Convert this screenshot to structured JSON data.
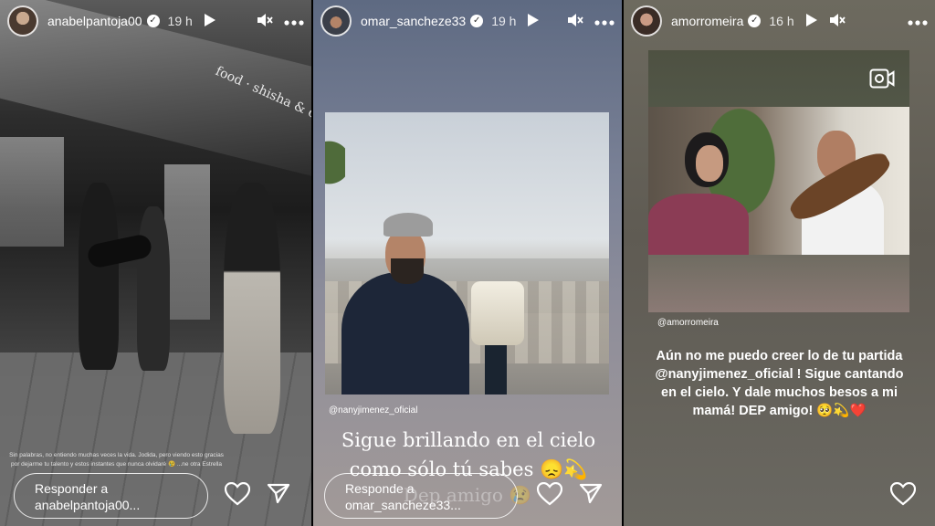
{
  "stories": [
    {
      "username": "anabelpantoja00",
      "time": "19 h",
      "storefront_text": "food · shisha & cocktails",
      "caption": "Sin palabras, no entiendo muchas veces la vida. Jodida, pero viendo esto gracias por dejarme tu talento y estos instantes que nunca olvidaré 😢 ...ne otra Estrella",
      "reply_placeholder": "Responder a anabelpantoja00..."
    },
    {
      "username": "omar_sancheze33",
      "time": "19 h",
      "mention": "@nanyjimenez_oficial",
      "quote_line1": "Sigue brillando en el cielo",
      "quote_line2": "como sólo tú sabes 😞💫",
      "quote_faded": "Dep amigo 😢",
      "reply_placeholder": "Responde a omar_sancheze33..."
    },
    {
      "username": "amorromeira",
      "time": "16 h",
      "mention": "@amorromeira",
      "message_line1": "Aún no me puedo creer lo de tu partida",
      "message_line2": "@nanyjimenez_oficial ! Sigue cantando",
      "message_line3": "en el cielo. Y dale muchos besos a mi",
      "message_line4": "mamá! DEP amigo! 🥺💫❤️"
    }
  ],
  "colors": {
    "text": "#ffffff",
    "verified_badge": "#ffffff"
  },
  "icons": [
    "play-icon",
    "mute-icon",
    "more-icon",
    "heart-icon",
    "send-icon",
    "camera-icon",
    "verified-icon"
  ]
}
